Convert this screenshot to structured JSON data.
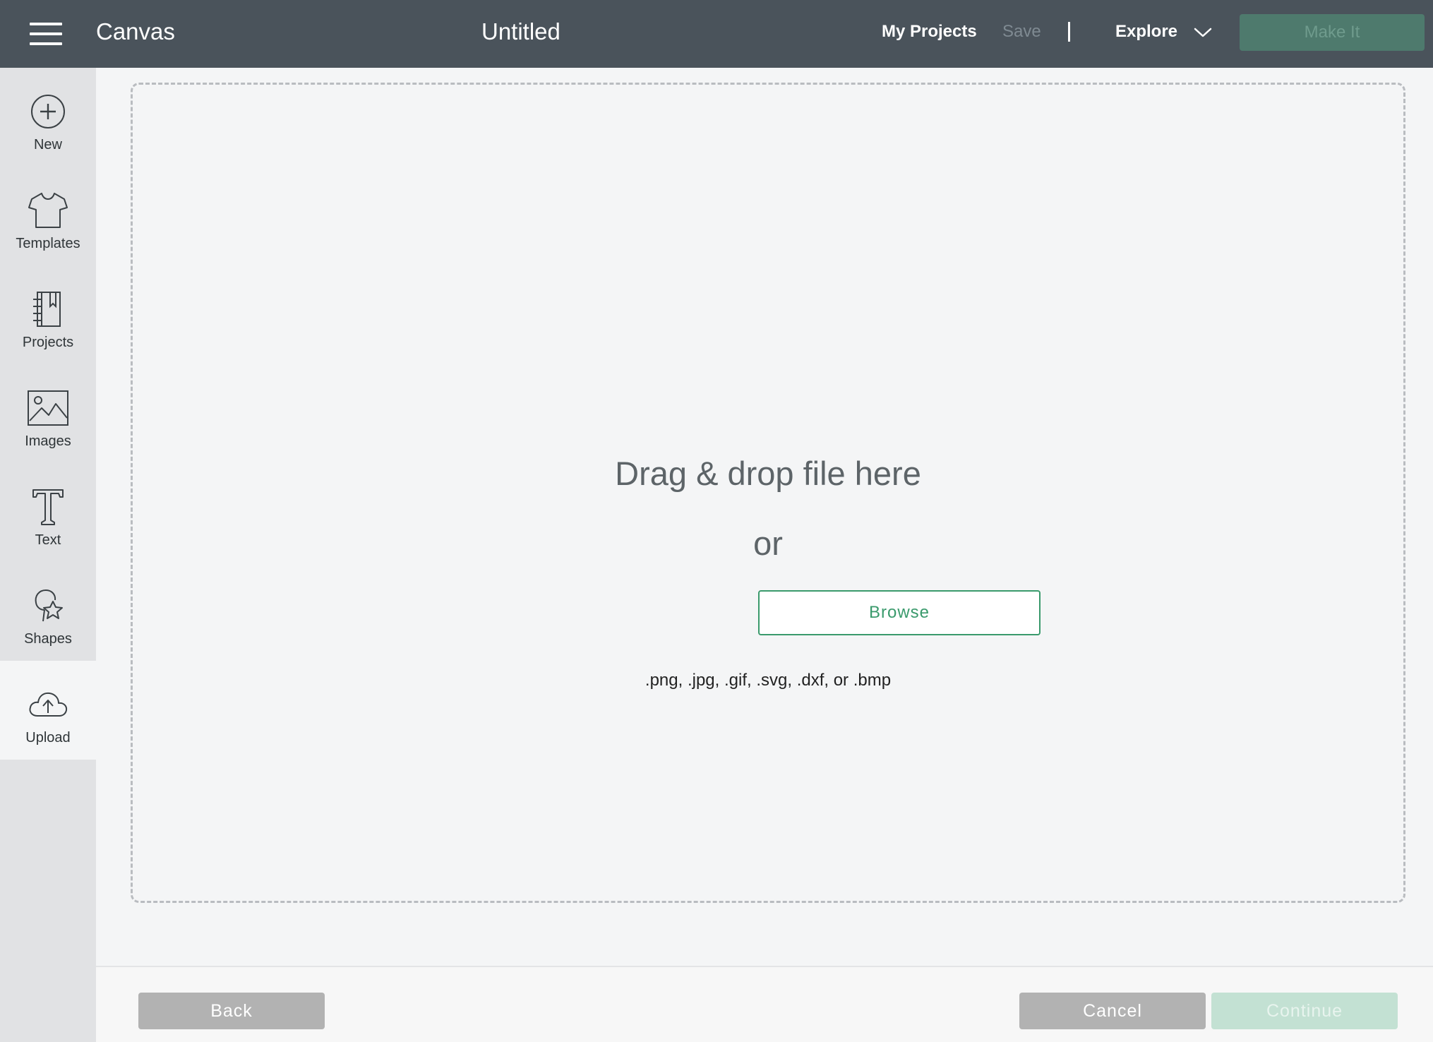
{
  "topbar": {
    "app_title": "Canvas",
    "document_title": "Untitled",
    "my_projects": "My Projects",
    "save": "Save",
    "divider": "|",
    "explore": "Explore",
    "make_it": "Make It"
  },
  "sidebar": {
    "items": [
      {
        "label": "New",
        "icon": "plus-circle-icon"
      },
      {
        "label": "Templates",
        "icon": "tshirt-icon"
      },
      {
        "label": "Projects",
        "icon": "notebook-icon"
      },
      {
        "label": "Images",
        "icon": "image-icon"
      },
      {
        "label": "Text",
        "icon": "text-t-icon"
      },
      {
        "label": "Shapes",
        "icon": "shapes-icon"
      },
      {
        "label": "Upload",
        "icon": "cloud-upload-icon",
        "active": true
      }
    ]
  },
  "dropzone": {
    "heading": "Drag & drop file here",
    "or": "or",
    "browse": "Browse",
    "formats": ".png, .jpg, .gif, .svg, .dxf, or .bmp"
  },
  "footer": {
    "back": "Back",
    "cancel": "Cancel",
    "continue": "Continue"
  },
  "colors": {
    "topbar": "#4a535b",
    "accent_green": "#3a9a6c",
    "sidebar": "#e1e2e4",
    "disabled_green": "#c3e1d3"
  }
}
